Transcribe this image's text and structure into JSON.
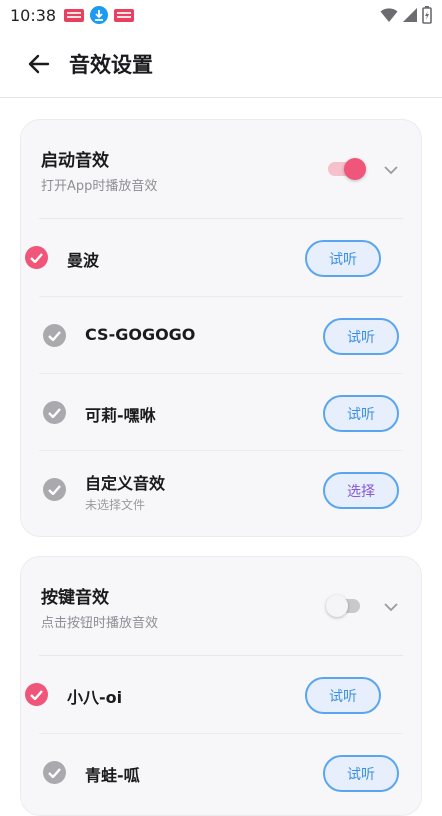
{
  "status_bar": {
    "time": "10:38"
  },
  "header": {
    "title": "音效设置"
  },
  "sections": [
    {
      "title": "启动音效",
      "subtitle": "打开App时播放音效",
      "enabled": true,
      "items": [
        {
          "label": "曼波",
          "checked": true,
          "action": "试听"
        },
        {
          "label": "CS-GOGOGO",
          "checked": false,
          "action": "试听"
        },
        {
          "label": "可莉-嘿咻",
          "checked": false,
          "action": "试听"
        },
        {
          "label": "自定义音效",
          "sub": "未选择文件",
          "checked": false,
          "action": "选择"
        }
      ]
    },
    {
      "title": "按键音效",
      "subtitle": "点击按钮时播放音效",
      "enabled": false,
      "items": [
        {
          "label": "小八-oi",
          "checked": true,
          "action": "试听"
        },
        {
          "label": "青蛙-呱",
          "checked": false,
          "action": "试听"
        }
      ]
    }
  ],
  "colors": {
    "accent": "#f0557a",
    "pill_border": "#5aa5ef",
    "pill_text": "#3c8fe6",
    "choose_text": "#8a57d6"
  }
}
